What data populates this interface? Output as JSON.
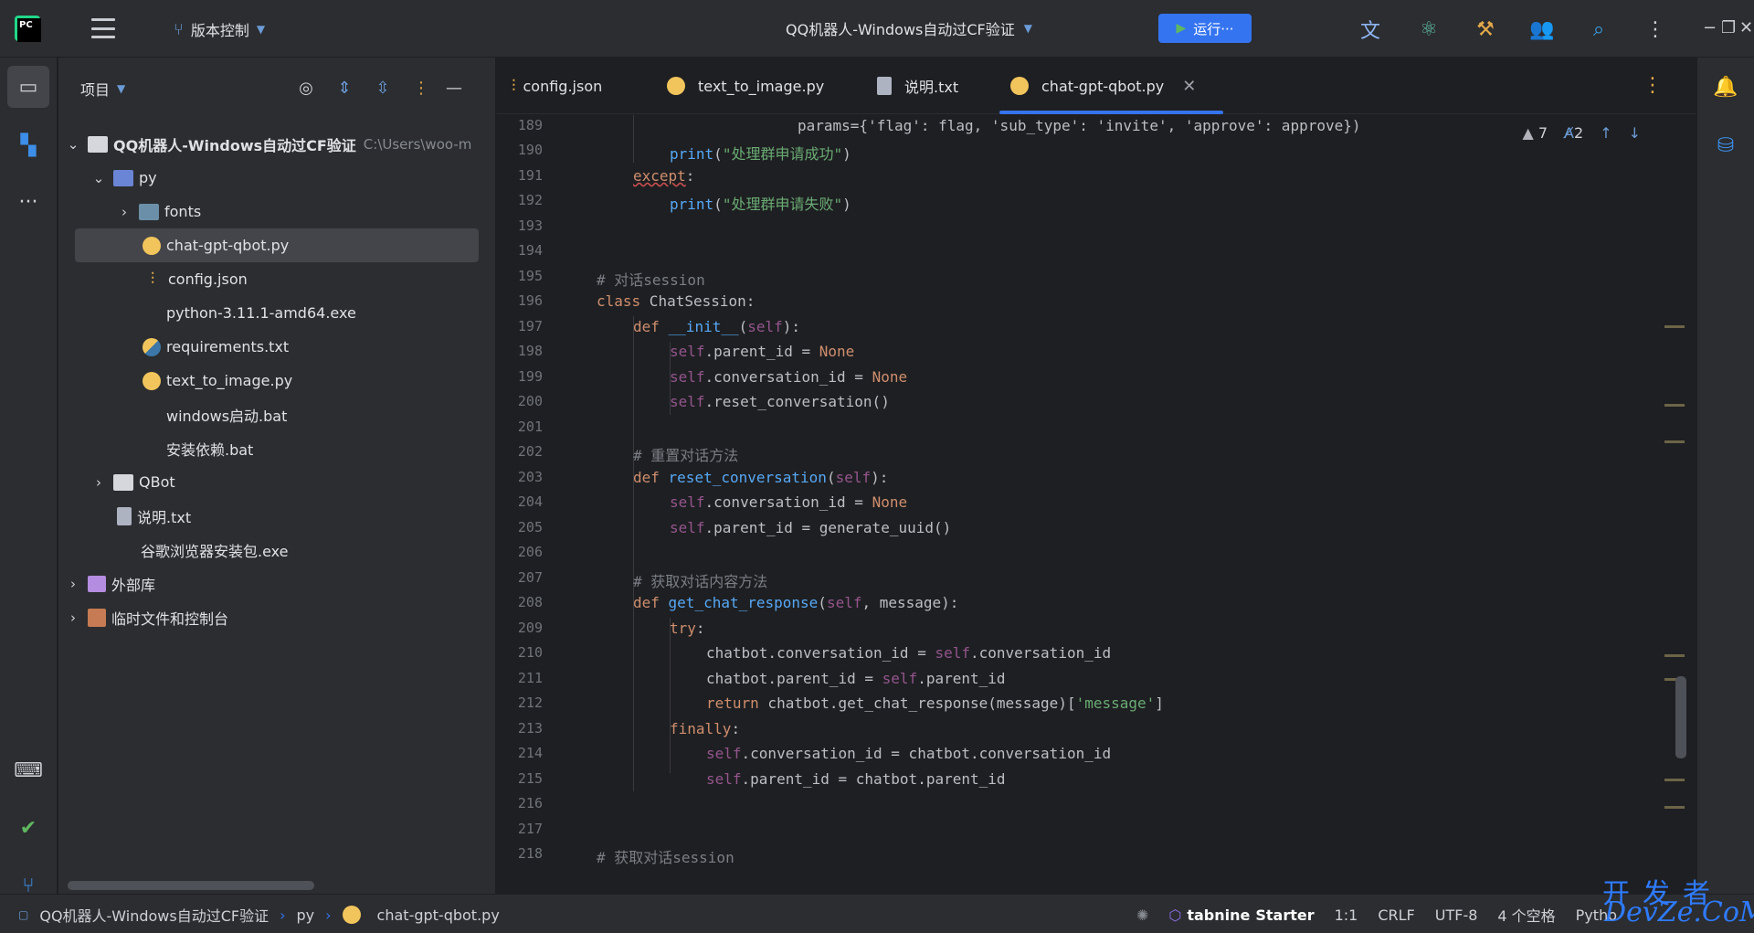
{
  "titlebar": {
    "vcs_label": "版本控制",
    "window_title": "QQ机器人-Windows自动过CF验证",
    "run_label": "运行···"
  },
  "project_panel": {
    "title": "项目",
    "root": {
      "name": "QQ机器人-Windows自动过CF验证",
      "path": "C:\\Users\\woo-m"
    },
    "items": [
      {
        "name": "py"
      },
      {
        "name": "fonts"
      },
      {
        "name": "chat-gpt-qbot.py"
      },
      {
        "name": "config.json"
      },
      {
        "name": "python-3.11.1-amd64.exe"
      },
      {
        "name": "requirements.txt"
      },
      {
        "name": "text_to_image.py"
      },
      {
        "name": "windows启动.bat"
      },
      {
        "name": "安装依赖.bat"
      },
      {
        "name": "QBot"
      },
      {
        "name": "说明.txt"
      },
      {
        "name": "谷歌浏览器安装包.exe"
      },
      {
        "name": "外部库"
      },
      {
        "name": "临时文件和控制台"
      }
    ]
  },
  "tabs": [
    {
      "label": "config.json"
    },
    {
      "label": "text_to_image.py"
    },
    {
      "label": "说明.txt"
    },
    {
      "label": "chat-gpt-qbot.py"
    }
  ],
  "inspections": {
    "warnings": "7",
    "typos": "2"
  },
  "line_numbers": [
    "189",
    "190",
    "191",
    "192",
    "193",
    "194",
    "195",
    "196",
    "197",
    "198",
    "199",
    "200",
    "201",
    "202",
    "203",
    "204",
    "205",
    "206",
    "207",
    "208",
    "209",
    "210",
    "211",
    "212",
    "213",
    "214",
    "215",
    "216",
    "217",
    "218"
  ],
  "code": {
    "l189": "params={'flag': flag, 'sub_type': 'invite', 'approve': approve})",
    "l190_fn": "print",
    "l190_str": "\"处理群申请成功\"",
    "l191": "except",
    "l192_fn": "print",
    "l192_str": "\"处理群申请失败\"",
    "l195": "# 对话session",
    "l196_kw": "class",
    "l196_rest": " ChatSession:",
    "l197_kw": "def",
    "l197_fn": " __init__",
    "l198": ".parent_id = ",
    "l199": ".conversation_id = ",
    "l200": ".reset_conversation()",
    "none": "None",
    "self": "self",
    "l202": "# 重置对话方法",
    "l203_fn": " reset_conversation",
    "l204": ".conversation_id = ",
    "l205": ".parent_id = generate_uuid()",
    "l207": "# 获取对话内容方法",
    "l208_fn": " get_chat_response",
    "l208_rest": ", message):",
    "l209": "try",
    "l210": "chatbot.conversation_id = ",
    "l210_tail": ".conversation_id",
    "l211": "chatbot.parent_id = ",
    "l211_tail": ".parent_id",
    "l212_kw": "return",
    "l212_rest": " chatbot.get_chat_response(message)[",
    "l212_str": "'message'",
    "l213": "finally",
    "l214": ".conversation_id = chatbot.conversation_id",
    "l215": ".parent_id = chatbot.parent_id",
    "l218": "# 获取对话session"
  },
  "statusbar": {
    "crumbs": [
      "QQ机器人-Windows自动过CF验证",
      "py",
      "chat-gpt-qbot.py"
    ],
    "tabnine": "tabnine",
    "tabnine_plan": "Starter",
    "position": "1:1",
    "line_sep": "CRLF",
    "encoding": "UTF-8",
    "indent": "4 个空格",
    "interpreter": "Pytho"
  },
  "watermark": {
    "line1": "开发者",
    "line2": "DevZe.CoM"
  }
}
